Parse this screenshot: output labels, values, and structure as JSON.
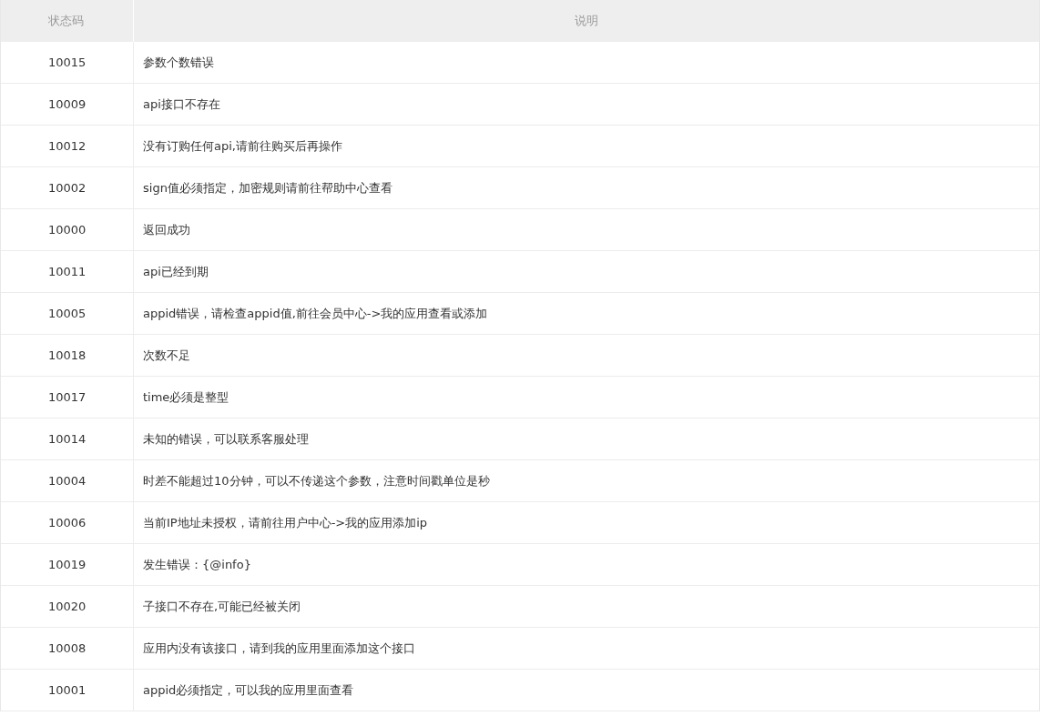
{
  "table": {
    "columns": [
      "状态码",
      "说明"
    ],
    "rows": [
      {
        "code": "10015",
        "description": "参数个数错误"
      },
      {
        "code": "10009",
        "description": "api接口不存在"
      },
      {
        "code": "10012",
        "description": "没有订购任何api,请前往购买后再操作"
      },
      {
        "code": "10002",
        "description": "sign值必须指定，加密规则请前往帮助中心查看"
      },
      {
        "code": "10000",
        "description": "返回成功"
      },
      {
        "code": "10011",
        "description": "api已经到期"
      },
      {
        "code": "10005",
        "description": "appid错误，请检查appid值,前往会员中心->我的应用查看或添加"
      },
      {
        "code": "10018",
        "description": "次数不足"
      },
      {
        "code": "10017",
        "description": "time必须是整型"
      },
      {
        "code": "10014",
        "description": "未知的错误，可以联系客服处理"
      },
      {
        "code": "10004",
        "description": "时差不能超过10分钟，可以不传递这个参数，注意时间戳单位是秒"
      },
      {
        "code": "10006",
        "description": "当前IP地址未授权，请前往用户中心->我的应用添加ip"
      },
      {
        "code": "10019",
        "description": "发生错误：{@info}"
      },
      {
        "code": "10020",
        "description": "子接口不存在,可能已经被关闭"
      },
      {
        "code": "10008",
        "description": "应用内没有该接口，请到我的应用里面添加这个接口"
      },
      {
        "code": "10001",
        "description": "appid必须指定，可以我的应用里面查看"
      }
    ]
  }
}
